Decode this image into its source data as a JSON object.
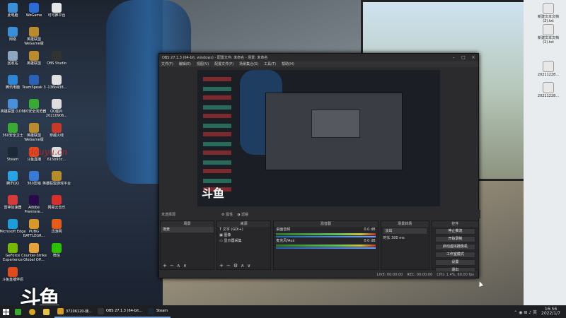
{
  "desktop_left_icons": [
    {
      "label": "此电脑",
      "color": "#3b8fd9"
    },
    {
      "label": "WeGame",
      "color": "#2a6bd6"
    },
    {
      "label": "可可推平台",
      "color": "#e6e6e6"
    },
    {
      "label": "网络",
      "color": "#3b8fd9"
    },
    {
      "label": "英雄联盟 WeGame版",
      "color": "#b98b2f"
    },
    {
      "label": "回收站",
      "color": "#8ea6bf"
    },
    {
      "label": "英雄联盟",
      "color": "#b98b2f"
    },
    {
      "label": "OBS Studio",
      "color": "#333333"
    },
    {
      "label": "腾讯电脑",
      "color": "#2f86d6"
    },
    {
      "label": "TeamSpeak 3",
      "color": "#2a63b5"
    },
    {
      "label": "-136b438...",
      "color": "#e0e0e0"
    },
    {
      "label": "英雄联盟 (LOL)",
      "color": "#4a90d9"
    },
    {
      "label": "360安全浏览器",
      "color": "#3aa935"
    },
    {
      "label": "QQ图片 20210906...",
      "color": "#dddddd"
    },
    {
      "label": "360安全卫士",
      "color": "#3aa935"
    },
    {
      "label": "英雄联盟 WeGame版",
      "color": "#b98b2f"
    },
    {
      "label": "穿越火线",
      "color": "#c43a2a"
    },
    {
      "label": "Steam",
      "color": "#1b2838"
    },
    {
      "label": "斗鱼直播",
      "color": "#e04a1f"
    },
    {
      "label": "615b93c...",
      "color": "#dddddd"
    },
    {
      "label": "腾讯QQ",
      "color": "#2aa2e6"
    },
    {
      "label": "360压缩",
      "color": "#3a7ad6"
    },
    {
      "label": "英雄联盟游戏平台",
      "color": "#b98b2f"
    },
    {
      "label": "雷神加速器",
      "color": "#d63a3a"
    },
    {
      "label": "Adobe Premiere...",
      "color": "#2a0a4a"
    },
    {
      "label": "网易云音乐",
      "color": "#d6302c"
    },
    {
      "label": "Microsoft Edge",
      "color": "#1f9dd9"
    },
    {
      "label": "PUBG BATTLEGR...",
      "color": "#d69a2a"
    },
    {
      "label": "迅游网",
      "color": "#e65a1a"
    },
    {
      "label": "GeForce Experience",
      "color": "#76b900"
    },
    {
      "label": "Counter-Strike Global Off...",
      "color": "#e6a23a"
    },
    {
      "label": "微信",
      "color": "#2dc100"
    },
    {
      "label": "斗鱼直播伴侣",
      "color": "#e04a1f"
    }
  ],
  "desktop_right_icons": [
    {
      "label": "新建文本文档(2).txt",
      "color": "#e8e8e8"
    },
    {
      "label": "新建文本文档(2).txt",
      "color": "#e8e8e8"
    },
    {
      "label": "20211228...",
      "color": "#e8e8e8"
    },
    {
      "label": "20211228...",
      "color": "#e8e8e8"
    }
  ],
  "watermark": "douyu.cn",
  "big_logo": "斗鱼",
  "obs": {
    "title": "OBS 27.1.3 (64-bit, windows) - 配置文件: 未命名 - 场景: 未命名",
    "menus": [
      "文件(F)",
      "编辑(E)",
      "视图(V)",
      "配置文件(P)",
      "场景集合(S)",
      "工具(T)",
      "帮助(H)"
    ],
    "source_label": "未选择源",
    "props_label": "属性",
    "filters_label": "滤镜",
    "docks": {
      "scenes": {
        "header": "场景",
        "items": [
          "场景"
        ]
      },
      "sources": {
        "header": "来源",
        "items": [
          "文字 (GDI+)",
          "图像",
          "显示器采集"
        ]
      },
      "mixer": {
        "header": "混音器",
        "channels": [
          {
            "name": "桌面音频",
            "db": "0.0 dB"
          },
          {
            "name": "麦克风/Aux",
            "db": "0.0 dB"
          }
        ]
      },
      "transitions": {
        "header": "场景转场",
        "type": "淡出",
        "duration_label": "时长",
        "duration": "300 ms"
      },
      "controls": {
        "header": "控件",
        "buttons": [
          "停止推流",
          "开始录制",
          "启动虚拟摄像机",
          "工作室模式",
          "设置",
          "退出"
        ]
      }
    },
    "status": {
      "live": "LIVE: 00:00:00",
      "rec": "REC: 00:00:00",
      "cpu": "CPU: 1.4%, 60.00 fps"
    }
  },
  "taskbar": {
    "apps": [
      {
        "label": "37206120-我...",
        "color": "#d69a2a"
      },
      {
        "label": "OBS 27.1.3 (64-bit...",
        "color": "#333333"
      },
      {
        "label": "Steam",
        "color": "#1b2838"
      }
    ],
    "time": "16:56",
    "date": "2022/1/7"
  }
}
